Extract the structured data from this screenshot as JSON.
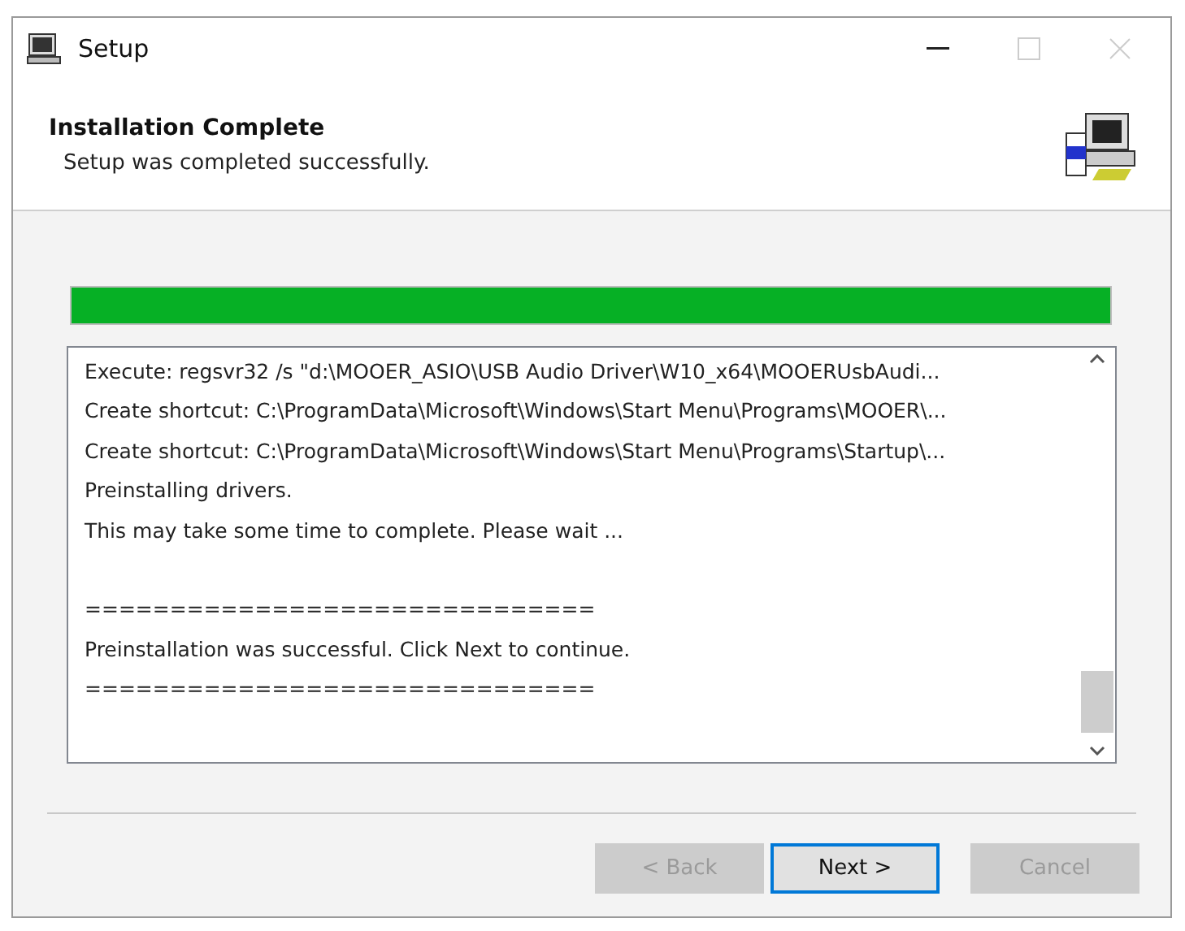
{
  "window": {
    "title": "Setup"
  },
  "header": {
    "title": "Installation Complete",
    "subtitle": "Setup was completed successfully."
  },
  "progress": {
    "level": 1
  },
  "log": [
    {
      "kind": "line",
      "text": "Execute: regsvr32 /s \"d:\\MOOER_ASIO\\USB Audio Driver\\W10_x64\\MOOERUsbAudi..."
    },
    {
      "kind": "line",
      "text": "Create shortcut: C:\\ProgramData\\Microsoft\\Windows\\Start Menu\\Programs\\MOOER\\..."
    },
    {
      "kind": "line",
      "text": "Create shortcut: C:\\ProgramData\\Microsoft\\Windows\\Start Menu\\Programs\\Startup\\..."
    },
    {
      "kind": "line",
      "text": "Preinstalling drivers."
    },
    {
      "kind": "line",
      "text": "This may take some time to complete. Please wait ..."
    },
    {
      "kind": "blank"
    },
    {
      "kind": "line",
      "text": "=============================="
    },
    {
      "kind": "line",
      "text": "Preinstallation was successful. Click Next to continue."
    },
    {
      "kind": "line",
      "text": "=============================="
    }
  ],
  "buttons": [
    {
      "label": "< Back",
      "disabled": true,
      "default": false
    },
    {
      "label": "Next >",
      "disabled": false,
      "default": true
    },
    {
      "label": "Cancel",
      "disabled": true,
      "default": false
    }
  ]
}
